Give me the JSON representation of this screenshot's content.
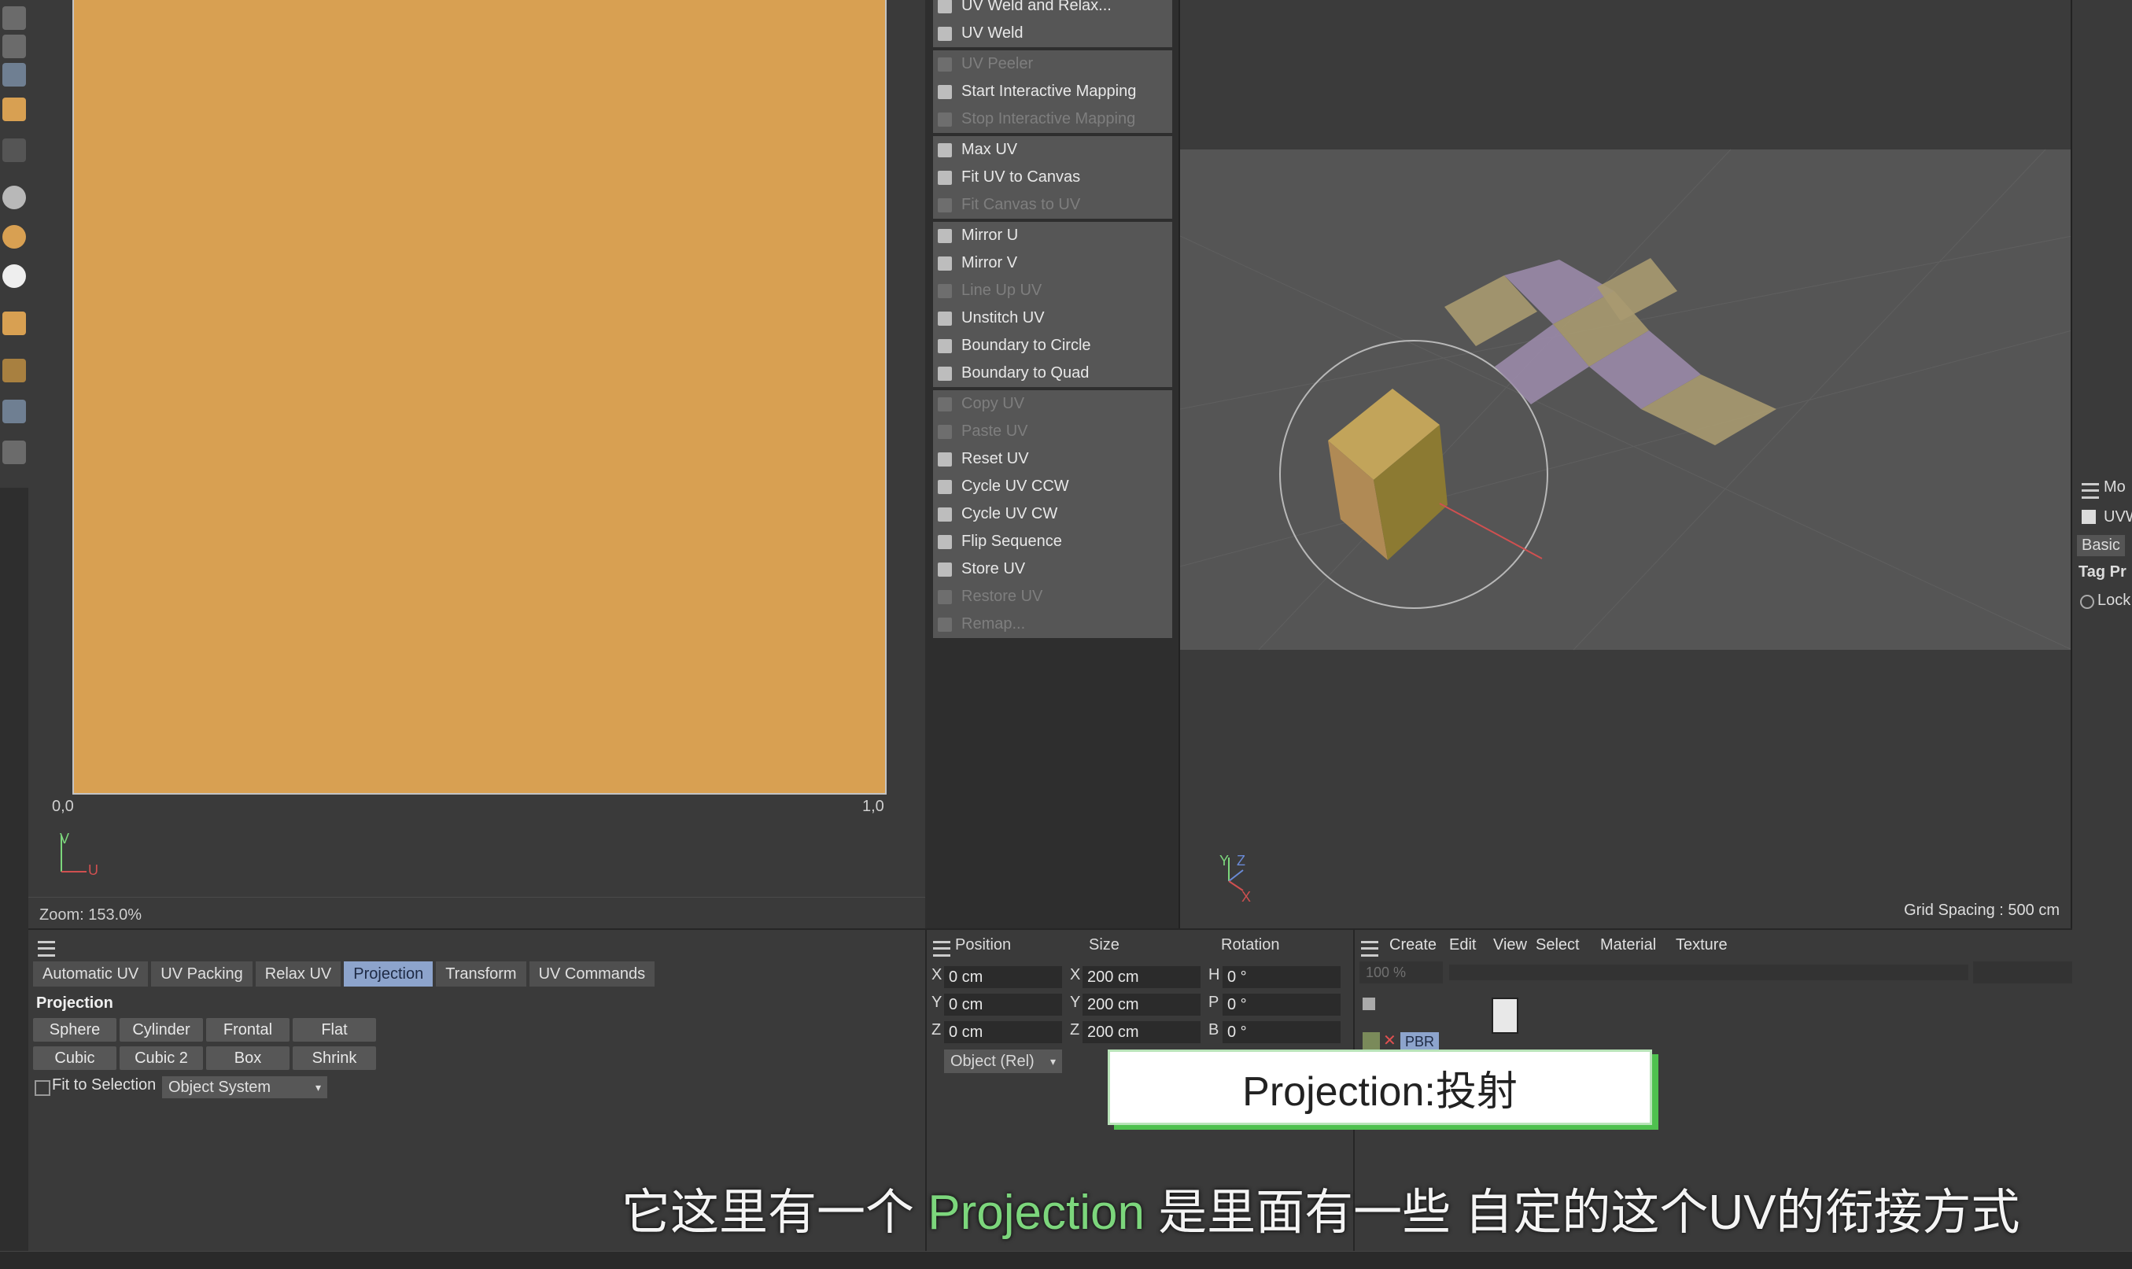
{
  "uv_editor": {
    "origin_label": "0,0",
    "one_label": "1,0",
    "axis_v": "V",
    "axis_u": "U",
    "zoom": "Zoom: 153.0%"
  },
  "uv_commands": {
    "groups": [
      [
        {
          "label": "UV Weld and Relax...",
          "disabled": false
        },
        {
          "label": "UV Weld",
          "disabled": false
        }
      ],
      [
        {
          "label": "UV Peeler",
          "disabled": true
        },
        {
          "label": "Start Interactive Mapping",
          "disabled": false
        },
        {
          "label": "Stop Interactive Mapping",
          "disabled": true
        }
      ],
      [
        {
          "label": "Max UV",
          "disabled": false
        },
        {
          "label": "Fit UV to Canvas",
          "disabled": false
        },
        {
          "label": "Fit Canvas to UV",
          "disabled": true
        }
      ],
      [
        {
          "label": "Mirror U",
          "disabled": false
        },
        {
          "label": "Mirror V",
          "disabled": false
        },
        {
          "label": "Line Up UV",
          "disabled": true
        },
        {
          "label": "Unstitch UV",
          "disabled": false
        },
        {
          "label": "Boundary to Circle",
          "disabled": false
        },
        {
          "label": "Boundary to Quad",
          "disabled": false
        }
      ],
      [
        {
          "label": "Copy UV",
          "disabled": true
        },
        {
          "label": "Paste UV",
          "disabled": true
        },
        {
          "label": "Reset UV",
          "disabled": false
        },
        {
          "label": "Cycle UV CCW",
          "disabled": false
        },
        {
          "label": "Cycle UV CW",
          "disabled": false
        },
        {
          "label": "Flip Sequence",
          "disabled": false
        },
        {
          "label": "Store UV",
          "disabled": false
        },
        {
          "label": "Restore UV",
          "disabled": true
        },
        {
          "label": "Remap...",
          "disabled": true
        }
      ]
    ]
  },
  "viewport": {
    "grid_spacing": "Grid Spacing : 500 cm",
    "axis_y": "Y",
    "axis_z": "Z",
    "axis_x": "X"
  },
  "right_panel": {
    "title": "Mo",
    "tag_name": "UVW",
    "tab_basic": "Basic",
    "section": "Tag Pr",
    "option": "Lock"
  },
  "uv_tabs": {
    "tabs": [
      "Automatic UV",
      "UV Packing",
      "Relax UV",
      "Projection",
      "Transform",
      "UV Commands"
    ],
    "active": "Projection"
  },
  "projection": {
    "title": "Projection",
    "buttons_row1": [
      "Sphere",
      "Cylinder",
      "Frontal",
      "Flat"
    ],
    "buttons_row2": [
      "Cubic",
      "Cubic 2",
      "Box",
      "Shrink"
    ],
    "fit_label": "Fit to Selection",
    "system_value": "Object System"
  },
  "coords": {
    "position_header": "Position",
    "size_header": "Size",
    "rotation_header": "Rotation",
    "rows": [
      {
        "axis": "X",
        "pos": "0 cm",
        "size_axis": "X",
        "size": "200 cm",
        "rot_axis": "H",
        "rot": "0 °"
      },
      {
        "axis": "Y",
        "pos": "0 cm",
        "size_axis": "Y",
        "size": "200 cm",
        "rot_axis": "P",
        "rot": "0 °"
      },
      {
        "axis": "Z",
        "pos": "0 cm",
        "size_axis": "Z",
        "size": "200 cm",
        "rot_axis": "B",
        "rot": "0 °"
      }
    ],
    "mode": "Object (Rel)"
  },
  "materials": {
    "menu": [
      "Create",
      "Edit",
      "View",
      "Select",
      "Material",
      "Texture"
    ],
    "zoom": "100 %",
    "material_name": "PBR"
  },
  "callout": "Projection:投射",
  "subtitle": {
    "before": "它这里有一个 ",
    "highlight": "Projection",
    "after": " 是里面有一些 自定的这个UV的衔接方式"
  },
  "colors": {
    "uv_canvas": "#d8a052",
    "active_tab": "#8da4cc",
    "highlight_green": "#7cd67c"
  }
}
